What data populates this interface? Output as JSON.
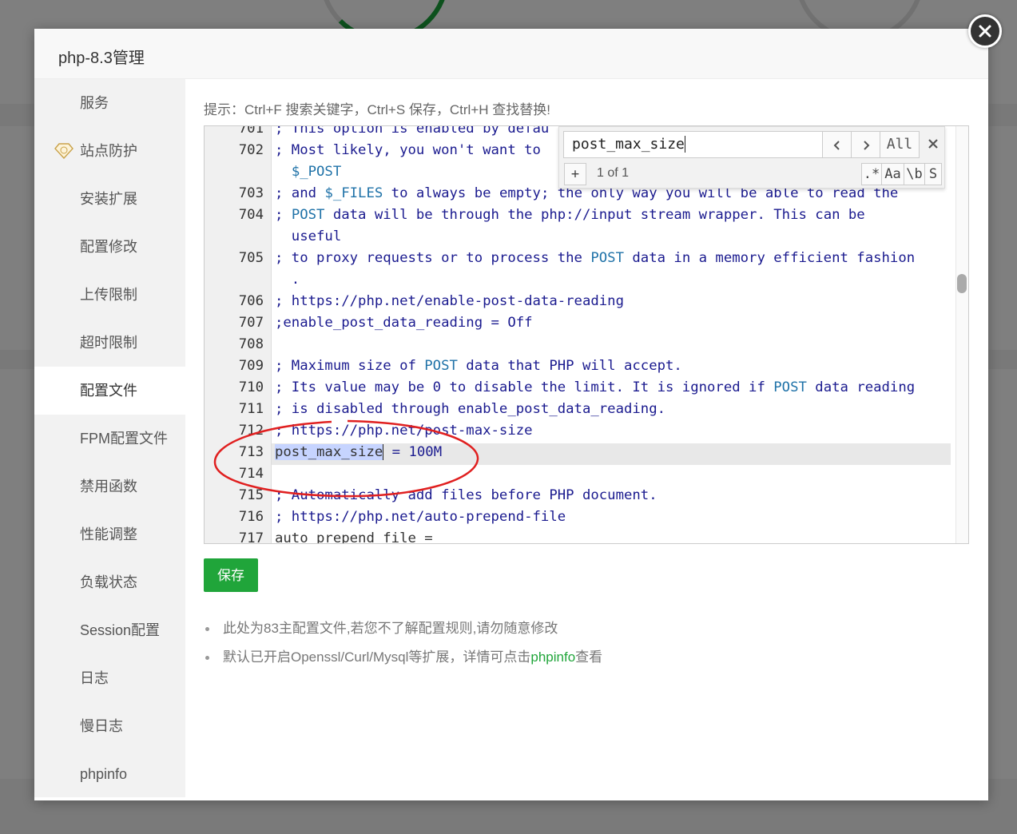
{
  "dialog": {
    "title": "php-8.3管理"
  },
  "sidebar": {
    "items": [
      {
        "label": "服务"
      },
      {
        "label": "站点防护"
      },
      {
        "label": "安装扩展"
      },
      {
        "label": "配置修改"
      },
      {
        "label": "上传限制"
      },
      {
        "label": "超时限制"
      },
      {
        "label": "配置文件"
      },
      {
        "label": "FPM配置文件"
      },
      {
        "label": "禁用函数"
      },
      {
        "label": "性能调整"
      },
      {
        "label": "负载状态"
      },
      {
        "label": "Session配置"
      },
      {
        "label": "日志"
      },
      {
        "label": "慢日志"
      },
      {
        "label": "phpinfo"
      }
    ],
    "active_index": 6
  },
  "main": {
    "hint": "提示：Ctrl+F 搜索关键字，Ctrl+S 保存，Ctrl+H 查找替换!",
    "save_label": "保存",
    "notes": [
      "此处为83主配置文件,若您不了解配置规则,请勿随意修改",
      "默认已开启Openssl/Curl/Mysql等扩展，详情可点击"
    ],
    "note2_link": "phpinfo",
    "note2_suffix": "查看"
  },
  "search": {
    "query": "post_max_size",
    "count": "1 of 1",
    "all_label": "All",
    "plus_label": "+",
    "regex_label": ".*",
    "case_label": "Aa",
    "word_label": "\\b",
    "select_label": "S"
  },
  "editor": {
    "lines": [
      {
        "n": "701",
        "t": "; This option is enabled by defau"
      },
      {
        "n": "702",
        "t": "; Most likely, you won't want to"
      },
      {
        "n": "",
        "t": "  $_POST"
      },
      {
        "n": "703",
        "t": "; and $_FILES to always be empty; the only way you will be able to read the"
      },
      {
        "n": "704",
        "t": "; POST data will be through the php://input stream wrapper. This can be"
      },
      {
        "n": "",
        "t": "  useful"
      },
      {
        "n": "705",
        "t": "; to proxy requests or to process the POST data in a memory efficient fashion"
      },
      {
        "n": "",
        "t": "  ."
      },
      {
        "n": "706",
        "t": "; https://php.net/enable-post-data-reading"
      },
      {
        "n": "707",
        "t": ";enable_post_data_reading = Off"
      },
      {
        "n": "708",
        "t": ""
      },
      {
        "n": "709",
        "t": "; Maximum size of POST data that PHP will accept."
      },
      {
        "n": "710",
        "t": "; Its value may be 0 to disable the limit. It is ignored if POST data reading"
      },
      {
        "n": "711",
        "t": "; is disabled through enable_post_data_reading."
      },
      {
        "n": "712",
        "t": "; https://php.net/post-max-size"
      },
      {
        "n": "713",
        "t": "post_max_size = 100M"
      },
      {
        "n": "714",
        "t": ""
      },
      {
        "n": "715",
        "t": "; Automatically add files before PHP document."
      },
      {
        "n": "716",
        "t": "; https://php.net/auto-prepend-file"
      },
      {
        "n": "717",
        "t": "auto_prepend_file ="
      }
    ],
    "highlight_line": "713"
  },
  "colors": {
    "accent": "#20a53a",
    "annotation": "#e02020",
    "comment": "#1b1b8f"
  }
}
